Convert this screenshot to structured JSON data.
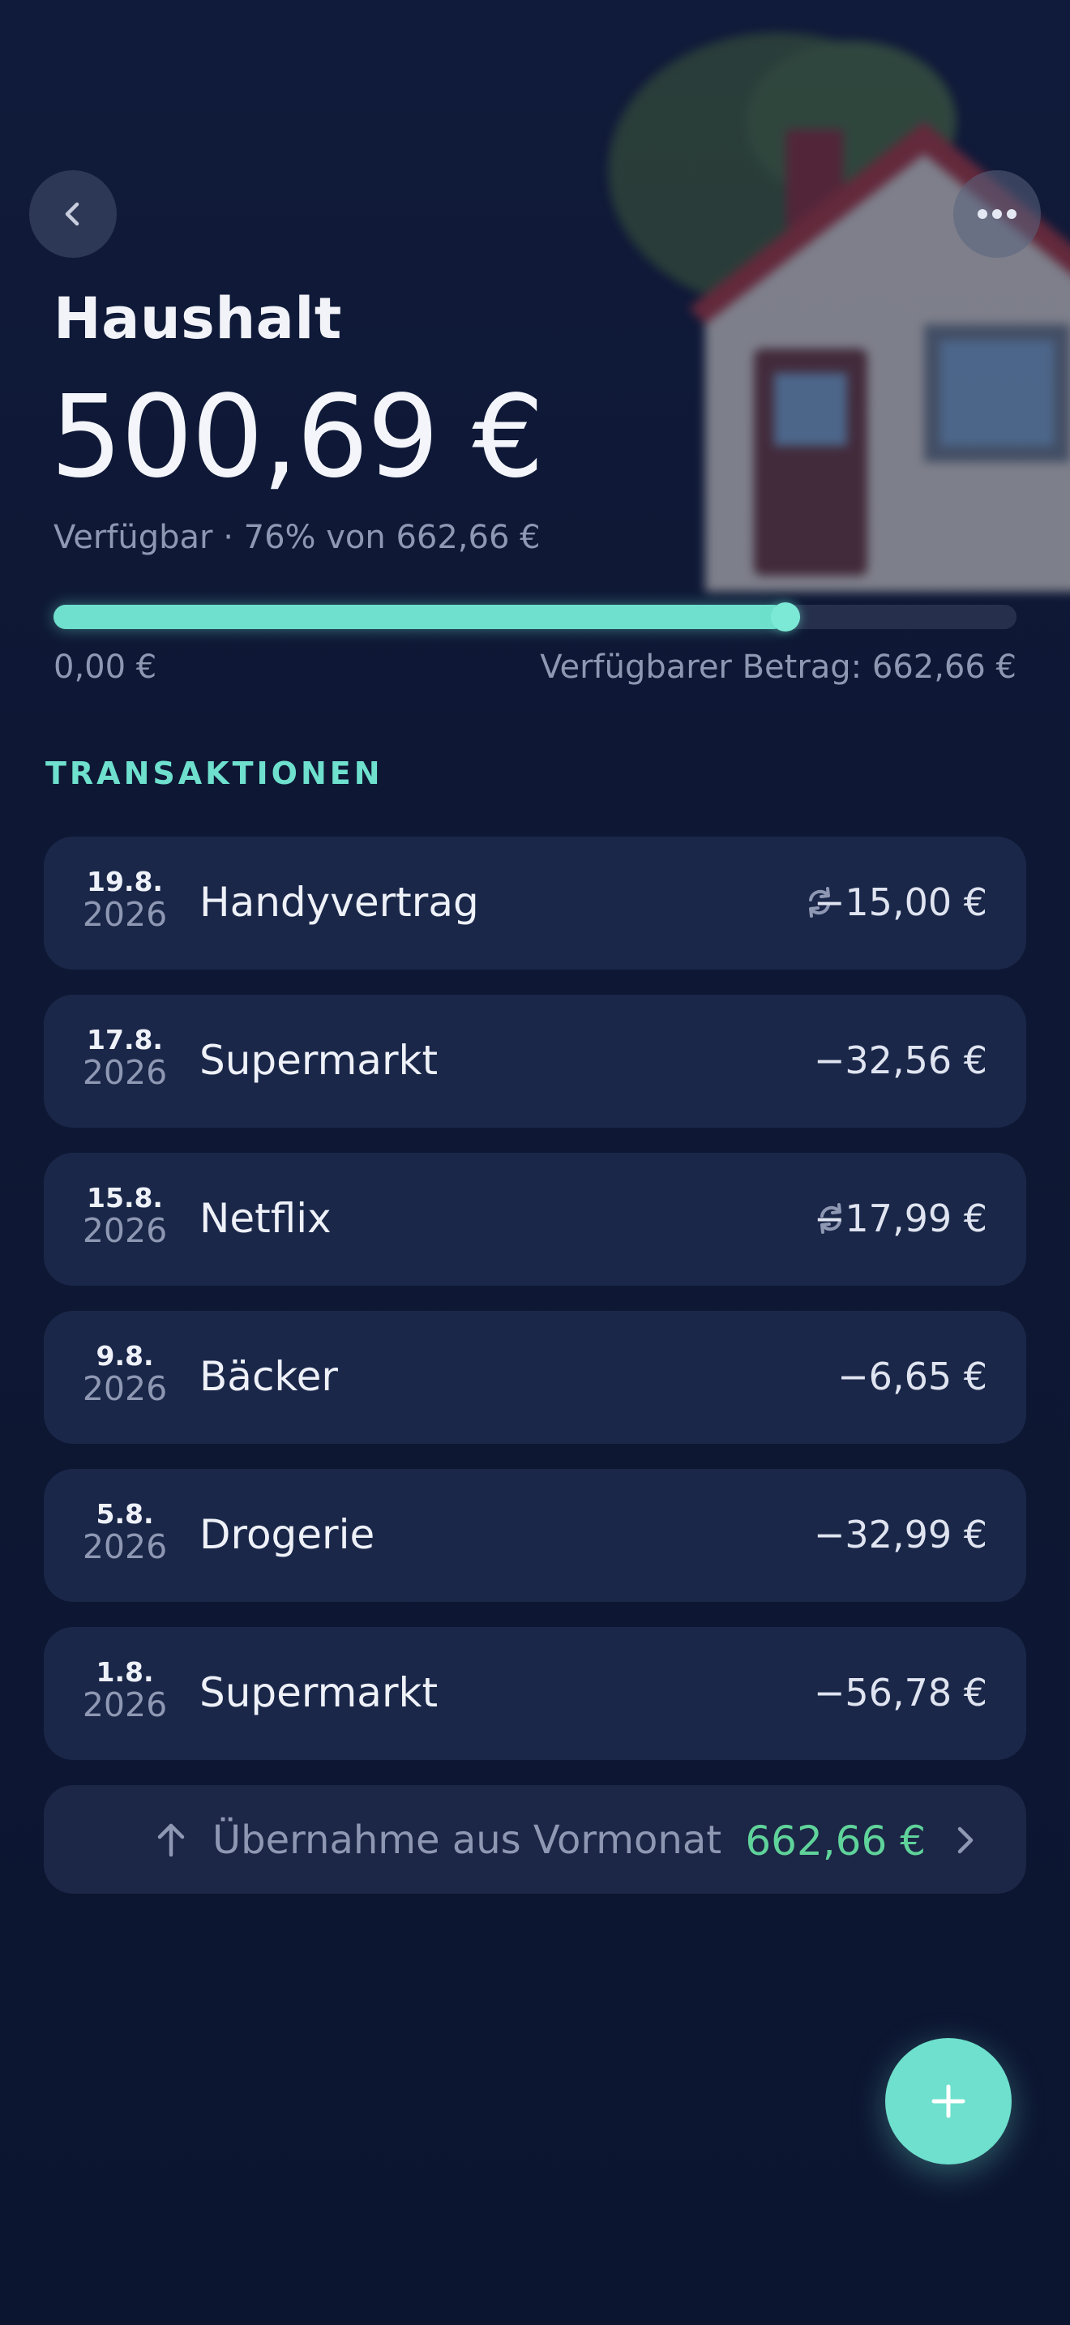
{
  "header": {
    "title": "Haushalt",
    "amount": "500,69 €",
    "subtitle": "Verfügbar · 76% von 662,66 €",
    "progress_fraction": 0.76,
    "range_min_label": "0,00 €",
    "range_max_label": "Verfügbarer Betrag: 662,66 €"
  },
  "section": {
    "title": "TRANSAKTIONEN"
  },
  "transactions": [
    {
      "day": "19.8.",
      "year": "2026",
      "name": "Handyvertrag",
      "amount": "−15,00 €",
      "recurring": true
    },
    {
      "day": "17.8.",
      "year": "2026",
      "name": "Supermarkt",
      "amount": "−32,56 €",
      "recurring": false
    },
    {
      "day": "15.8.",
      "year": "2026",
      "name": "Netflix",
      "amount": "−17,99 €",
      "recurring": true
    },
    {
      "day": "9.8.",
      "year": "2026",
      "name": "Bäcker",
      "amount": "−6,65 €",
      "recurring": false
    },
    {
      "day": "5.8.",
      "year": "2026",
      "name": "Drogerie",
      "amount": "−32,99 €",
      "recurring": false
    },
    {
      "day": "1.8.",
      "year": "2026",
      "name": "Supermarkt",
      "amount": "−56,78 €",
      "recurring": false
    }
  ],
  "carryover": {
    "label": "Übernahme aus Vormonat",
    "amount": "662,66 €"
  },
  "icons": {
    "back": "chevron-left-icon",
    "more": "more-horizontal-icon",
    "recurring": "repeat-icon",
    "carryover": "arrow-up-icon",
    "chevron": "chevron-right-icon",
    "add": "plus-icon",
    "background": "house-illustration"
  },
  "colors": {
    "background": "#0e1834",
    "card": "#1a2749",
    "accent": "#6ee0cd",
    "positive": "#5fd39a",
    "muted": "#8f98b3"
  }
}
